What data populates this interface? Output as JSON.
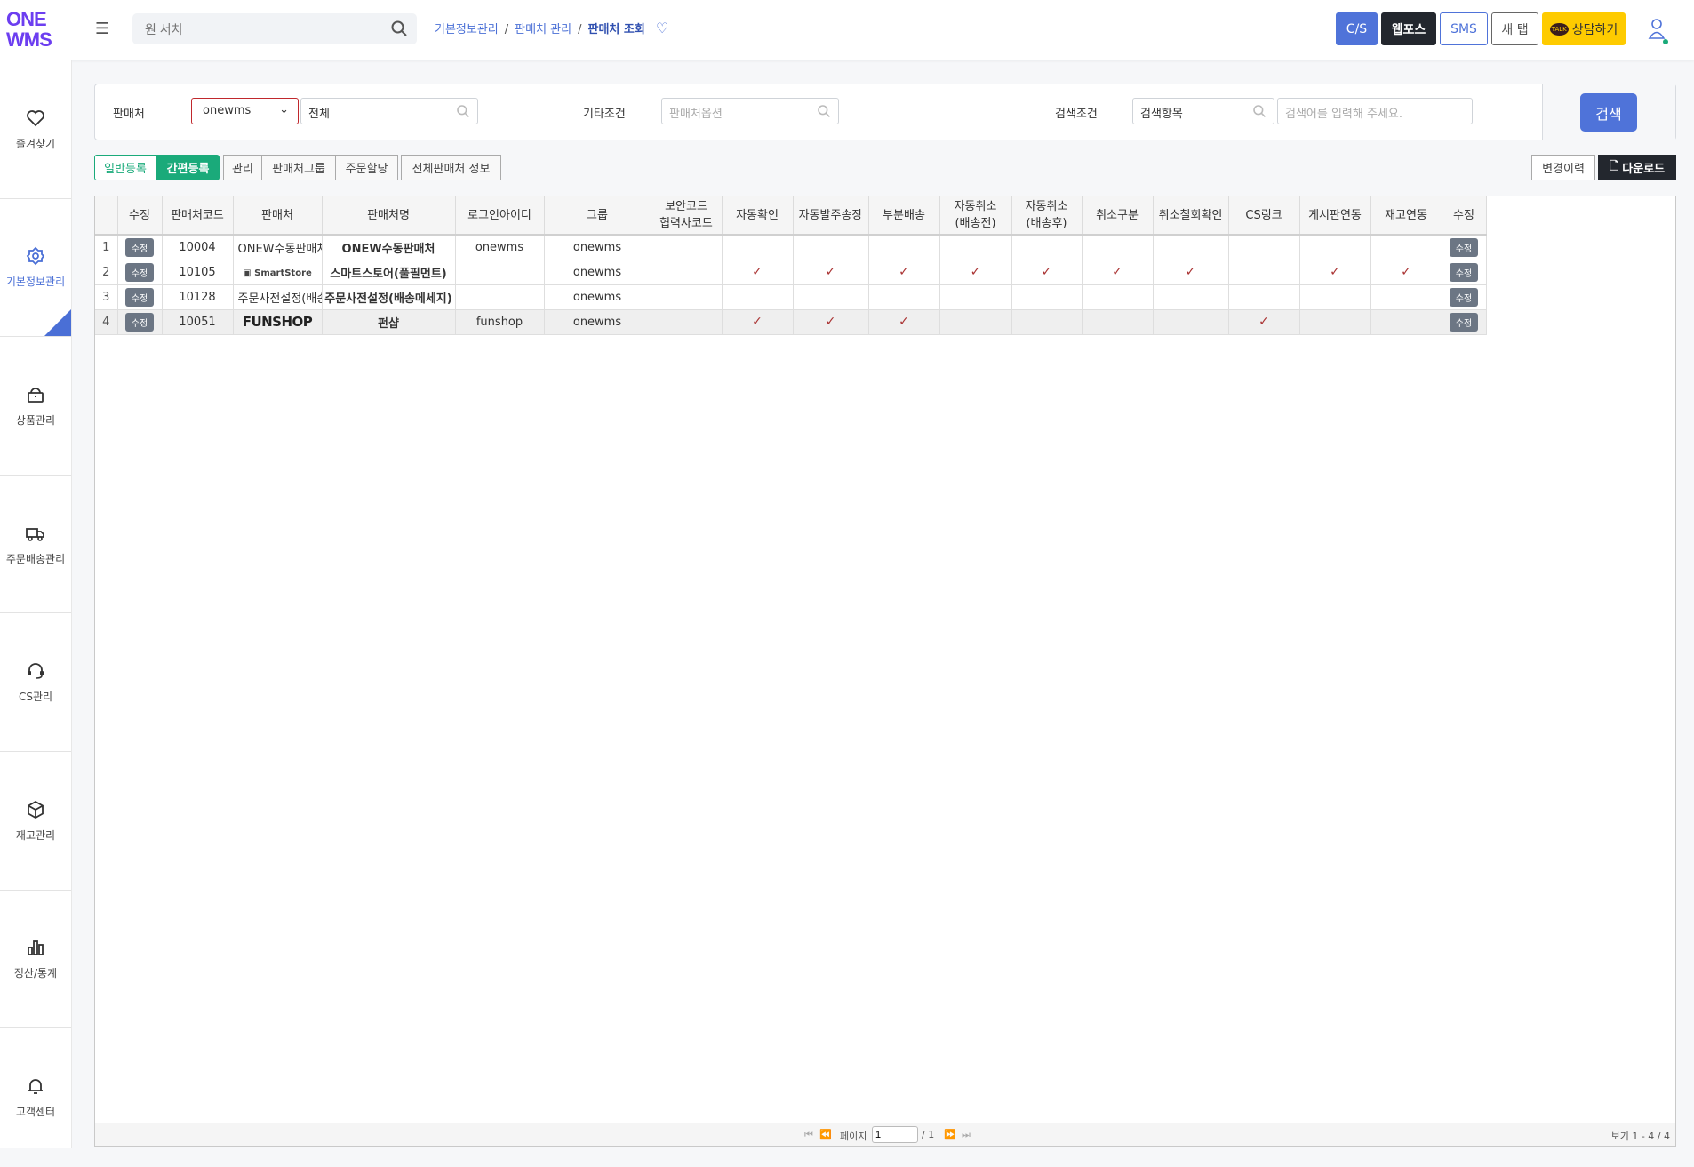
{
  "header": {
    "logo": "ONE WMS",
    "search_placeholder": "원 서치",
    "breadcrumb": [
      "기본정보관리",
      "판매처 관리",
      "판매처 조회"
    ],
    "buttons": {
      "cs": "C/S",
      "webpos": "웹포스",
      "sms": "SMS",
      "newtab": "새 탭",
      "talk": "상담하기"
    }
  },
  "sidebar": {
    "items": [
      {
        "label": "즐겨찾기",
        "icon": "heart-icon"
      },
      {
        "label": "기본정보관리",
        "icon": "gear-icon",
        "active": true
      },
      {
        "label": "상품관리",
        "icon": "bag-icon"
      },
      {
        "label": "주문배송관리",
        "icon": "truck-icon"
      },
      {
        "label": "CS관리",
        "icon": "headset-icon"
      },
      {
        "label": "재고관리",
        "icon": "box-icon"
      },
      {
        "label": "정산/통계",
        "icon": "chart-icon"
      },
      {
        "label": "고객센터",
        "icon": "bell-icon"
      }
    ]
  },
  "filters": {
    "seller_label": "판매처",
    "seller_select": "onewms",
    "seller_value": "전체",
    "etc_label": "기타조건",
    "etc_placeholder": "판매처옵션",
    "cond_label": "검색조건",
    "cond_select": "검색항목",
    "keyword_placeholder": "검색어를 입력해 주세요.",
    "search_button": "검색"
  },
  "toolbar": {
    "general": "일반등록",
    "quick": "간편등록",
    "manage": "관리",
    "group": "판매처그룹",
    "alloc": "주문할당",
    "allinfo": "전체판매처 정보",
    "history": "변경이력",
    "download": "다운로드"
  },
  "table": {
    "columns": [
      "",
      "수정",
      "판매처코드",
      "판매처",
      "판매처명",
      "로그인아이디",
      "그룹",
      "보안코드\n협력사코드",
      "자동확인",
      "자동발주송장",
      "부분배송",
      "자동취소\n(배송전)",
      "자동취소\n(배송후)",
      "취소구분",
      "취소철회확인",
      "CS링크",
      "게시판연동",
      "재고연동",
      "수정"
    ],
    "edit_label": "수정",
    "rows": [
      {
        "no": "1",
        "code": "10004",
        "seller": "ONEW수동판매처",
        "name": "ONEW수동판매처",
        "login": "onewms",
        "group": "onewms",
        "security": "",
        "checks": [
          false,
          false,
          false,
          false,
          false,
          false,
          false,
          false,
          false,
          false
        ]
      },
      {
        "no": "2",
        "code": "10105",
        "seller": "SmartStore",
        "name": "스마트스토어(풀필먼트)",
        "login": "",
        "group": "onewms",
        "security": "",
        "checks": [
          true,
          true,
          true,
          true,
          true,
          true,
          true,
          false,
          true,
          true
        ]
      },
      {
        "no": "3",
        "code": "10128",
        "seller": "주문사전설정(배송메세지)",
        "name": "주문사전설정(배송메세지)",
        "login": "",
        "group": "onewms",
        "security": "",
        "checks": [
          false,
          false,
          false,
          false,
          false,
          false,
          false,
          false,
          false,
          false
        ]
      },
      {
        "no": "4",
        "code": "10051",
        "seller": "FUNSHOP",
        "name": "펀샵",
        "login": "funshop",
        "group": "onewms",
        "security": "",
        "checks": [
          true,
          true,
          true,
          false,
          false,
          false,
          false,
          true,
          false,
          false
        ]
      }
    ]
  },
  "pager": {
    "page_label": "페이지",
    "page": "1",
    "total": "/ 1",
    "view": "보기 1 - 4 / 4"
  },
  "colors": {
    "accent": "#4f73d9",
    "green": "#1aaa7a",
    "dark": "#23272e",
    "talk": "#fecb00",
    "check": "#aa3333"
  }
}
